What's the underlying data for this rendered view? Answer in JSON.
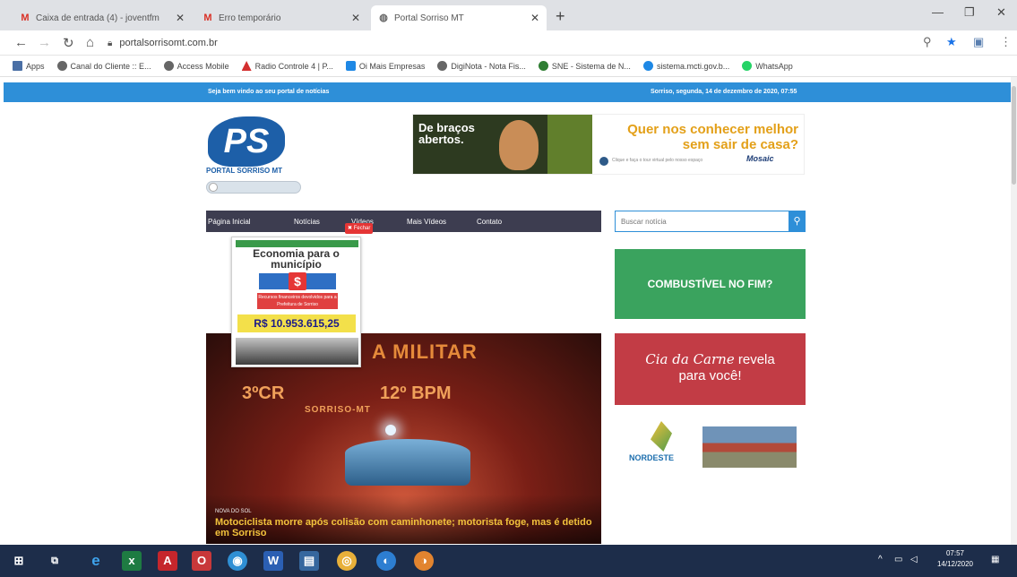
{
  "browser": {
    "tabs": [
      {
        "title": "Caixa de entrada (4) - joventfm",
        "favicon": "gmail-icon"
      },
      {
        "title": "Erro temporário",
        "favicon": "gmail-icon"
      },
      {
        "title": "Portal Sorriso MT",
        "favicon": "globe-icon",
        "active": true
      }
    ],
    "new_tab_label": "+",
    "url": "portalsorrisomt.com.br",
    "bookmarks": [
      {
        "label": "Apps",
        "icon": "apps-grid-icon",
        "color": "#555555"
      },
      {
        "label": "Canal do Cliente :: E...",
        "icon": "globe-icon",
        "color": "#555555"
      },
      {
        "label": "Access Mobile",
        "icon": "globe-icon",
        "color": "#555555"
      },
      {
        "label": "Radio Controle 4 | P...",
        "icon": "radio-icon",
        "color": "#d32f2f"
      },
      {
        "label": "Oi Mais Empresas",
        "icon": "oi-icon",
        "color": "#1e88e5"
      },
      {
        "label": "DigiNota - Nota Fis...",
        "icon": "globe-icon",
        "color": "#555555"
      },
      {
        "label": "SNE - Sistema de N...",
        "icon": "sne-icon",
        "color": "#2e7d32"
      },
      {
        "label": "sistema.mcti.gov.b...",
        "icon": "mcti-icon",
        "color": "#1e88e5"
      },
      {
        "label": "WhatsApp",
        "icon": "whatsapp-icon",
        "color": "#25d366"
      }
    ]
  },
  "site": {
    "welcome": "Seja bem vindo ao seu portal de notícias",
    "date": "Sorriso, segunda, 14 de dezembro de 2020, 07:55",
    "logo": {
      "mark": "PS",
      "text": "PORTAL SORRISO MT"
    },
    "banner": {
      "slogan": "De braços abertos.",
      "headline": "Quer nos conhecer melhor sem sair de casa?",
      "sub": "Clique e faça o tour virtual pelo nosso espaço",
      "brand": "Mosaic"
    },
    "menu": [
      "Página Inicial",
      "Notícias",
      "Vídeos",
      "Mais Vídeos",
      "Contato"
    ],
    "close_badge": "✖ Fechar",
    "search": {
      "placeholder": "Buscar notícia"
    },
    "popup": {
      "title": "Economia para o município",
      "red_text": "Recursos financeiros devolvidos para a Prefeitura de Sorriso",
      "amount": "R$ 10.953.615,25"
    },
    "feature": {
      "sign_top": "A MILITAR",
      "sign_left": "3ºCR",
      "sign_right": "12º BPM",
      "sign_city": "SORRISO-MT",
      "category": "Nova do Sol",
      "headline": "Motociclista morre após colisão com caminhonete; motorista foge, mas é detido em Sorriso"
    },
    "ads": {
      "green": "COMBUSTÍVEL NO FIM?",
      "red_brand": "Cia da Carne",
      "red_line1": "revela",
      "red_line2": "para você!",
      "nordeste": "NORDESTE"
    }
  },
  "taskbar": {
    "time": "07:57",
    "date": "14/12/2020"
  },
  "colors": {
    "site_blue": "#2e8fd8",
    "menu_dark": "#3d3d50",
    "ad_green": "#3aa35e",
    "ad_red": "#c23c45",
    "taskbar": "#1d2d4a"
  }
}
